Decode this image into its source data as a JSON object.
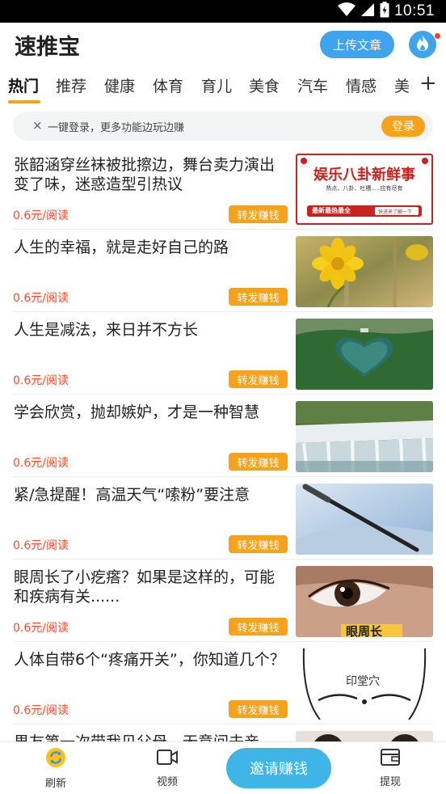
{
  "status_bar": {
    "time": "10:51"
  },
  "app": {
    "title": "速推宝",
    "upload_label": "上传文章"
  },
  "tabs": [
    {
      "label": "热门"
    },
    {
      "label": "推荐"
    },
    {
      "label": "健康"
    },
    {
      "label": "体育"
    },
    {
      "label": "育儿"
    },
    {
      "label": "美食"
    },
    {
      "label": "汽车"
    },
    {
      "label": "情感"
    },
    {
      "label": "美"
    }
  ],
  "tab_add": "+",
  "login_bar": {
    "close": "×",
    "text": "一键登录，更多功能边玩边赚",
    "button": "登录"
  },
  "feed": {
    "items": [
      {
        "title": "张韶涵穿丝袜被批擦边，舞台卖力演出变了味，迷惑造型引热议",
        "price": "0.6元/阅读",
        "share": "转发赚钱"
      },
      {
        "title": "人生的幸福，就是走好自己的路",
        "price": "0.6元/阅读",
        "share": "转发赚钱"
      },
      {
        "title": "人生是减法，来日并不方长",
        "price": "0.6元/阅读",
        "share": "转发赚钱"
      },
      {
        "title": "学会欣赏，抛却嫉妒，才是一种智慧",
        "price": "0.6元/阅读",
        "share": "转发赚钱"
      },
      {
        "title": "紧/急提醒！高温天气“嗦粉”要注意",
        "price": "0.6元/阅读",
        "share": "转发赚钱"
      },
      {
        "title": "眼周长了小疙瘩？如果是这样的，可能和疾病有关......",
        "price": "0.6元/阅读",
        "share": "转发赚钱"
      },
      {
        "title": "人体自带6个“疼痛开关”，你知道几个？",
        "price": "0.6元/阅读",
        "share": "转发赚钱"
      },
      {
        "title": "男友第一次带我见父母，无意间去亲",
        "price": "",
        "share": ""
      }
    ]
  },
  "thumb_text": {
    "ent_title": "娱乐八卦新鲜事",
    "ent_sub": "热点、八卦、吐槽.....应有尽有",
    "ent_banner": "最新最热最全",
    "ent_tag": "快进来了解一下",
    "eye_caption": "眼周长",
    "acupoint": "印堂穴"
  },
  "bottom_nav": {
    "refresh": "刷新",
    "video": "视频",
    "invite": "邀请赚钱",
    "withdraw": "提现"
  }
}
